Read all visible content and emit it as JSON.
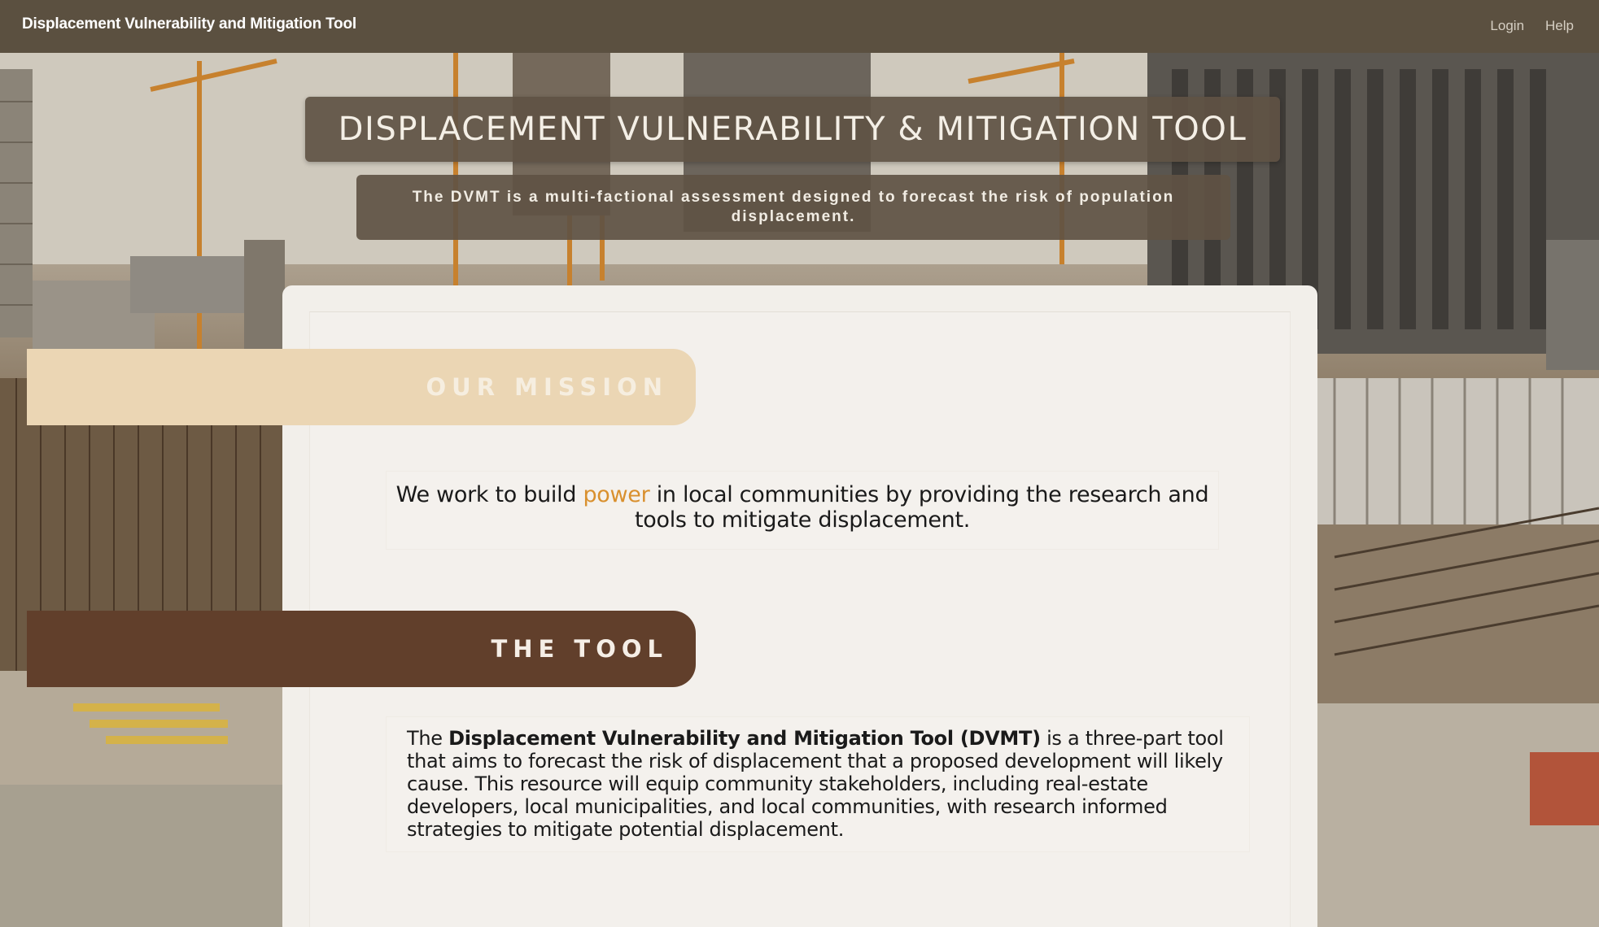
{
  "navbar": {
    "brand": "Displacement Vulnerability and Mitigation Tool",
    "links": [
      {
        "label": "Login"
      },
      {
        "label": "Help"
      }
    ]
  },
  "hero": {
    "title": "DISPLACEMENT VULNERABILITY & MITIGATION TOOL",
    "subtitle": "The DVMT is a multi-factional assessment designed to forecast the risk of population displacement."
  },
  "mission": {
    "heading": "OUR MISSION",
    "text_before": "We work to build ",
    "text_accent": "power",
    "text_after": " in local communities by providing the research and tools to mitigate displacement."
  },
  "tool": {
    "heading": "THE TOOL",
    "text_before": "The ",
    "text_bold": "Displacement Vulnerability and Mitigation Tool (DVMT)",
    "text_after": " is a three-part tool that aims to forecast the risk of displacement that a proposed development will likely cause. This resource will equip community stakeholders, including real-estate developers, local municipalities, and local communities, with research informed strategies to mitigate potential displacement."
  },
  "colors": {
    "navbar": "#5b5040",
    "mission_pill": "#ebd6b4",
    "tool_pill": "#613f2b",
    "accent": "#d9902e",
    "card": "#f2efea"
  },
  "background": {
    "icon": "construction-site-photo"
  }
}
